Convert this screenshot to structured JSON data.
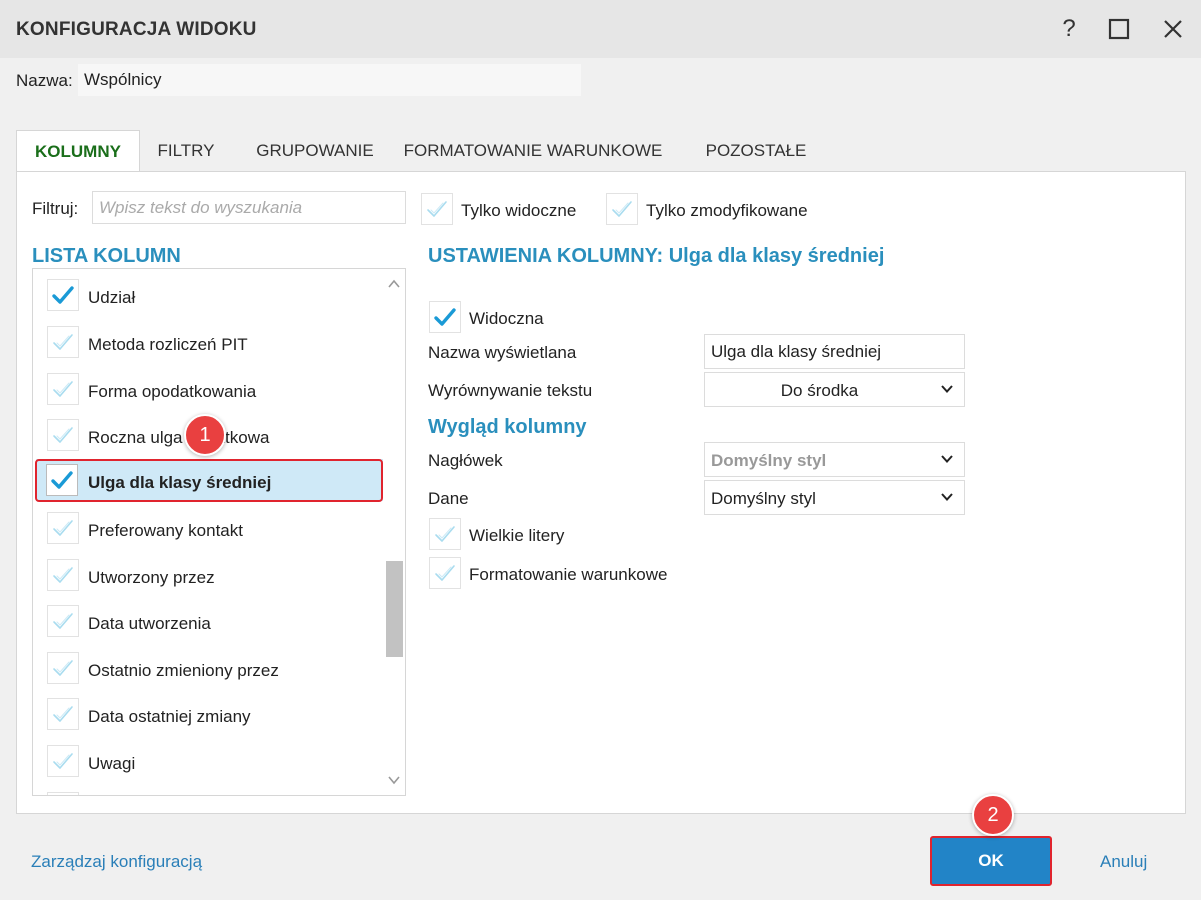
{
  "window": {
    "title": "KONFIGURACJA WIDOKU",
    "help_icon": "question-icon",
    "maximize_icon": "maximize-icon",
    "close_icon": "close-icon"
  },
  "name": {
    "label": "Nazwa:",
    "value": "Wspólnicy"
  },
  "tabs": [
    {
      "label": "KOLUMNY",
      "active": true
    },
    {
      "label": "FILTRY",
      "active": false
    },
    {
      "label": "GRUPOWANIE",
      "active": false
    },
    {
      "label": "FORMATOWANIE WARUNKOWE",
      "active": false
    },
    {
      "label": "POZOSTAŁE",
      "active": false
    }
  ],
  "filter": {
    "label": "Filtruj:",
    "placeholder": "Wpisz tekst do wyszukania",
    "only_visible": {
      "label": "Tylko widoczne",
      "checked": false
    },
    "only_modified": {
      "label": "Tylko zmodyfikowane",
      "checked": false
    }
  },
  "column_list": {
    "heading": "LISTA KOLUMN",
    "items": [
      {
        "label": "Udział",
        "checked": true
      },
      {
        "label": "Metoda rozliczeń PIT",
        "checked": false
      },
      {
        "label": "Forma opodatkowania",
        "checked": false
      },
      {
        "label": "Roczna ulga podatkowa",
        "checked": false
      },
      {
        "label": "Ulga dla klasy średniej",
        "checked": true,
        "selected": true
      },
      {
        "label": "Preferowany kontakt",
        "checked": false
      },
      {
        "label": "Utworzony przez",
        "checked": false
      },
      {
        "label": "Data utworzenia",
        "checked": false
      },
      {
        "label": "Ostatnio zmieniony przez",
        "checked": false
      },
      {
        "label": "Data ostatniej zmiany",
        "checked": false
      },
      {
        "label": "Uwagi",
        "checked": false
      }
    ]
  },
  "settings": {
    "heading": "USTAWIENIA KOLUMNY: Ulga dla klasy średniej",
    "visible": {
      "label": "Widoczna",
      "checked": true
    },
    "display_name": {
      "label": "Nazwa wyświetlana",
      "value": "Ulga dla klasy średniej"
    },
    "text_align": {
      "label": "Wyrównywanie tekstu",
      "value": "Do środka"
    },
    "appearance_heading": "Wygląd kolumny",
    "header_style": {
      "label": "Nagłówek",
      "value": "Domyślny styl"
    },
    "data_style": {
      "label": "Dane",
      "value": "Domyślny styl"
    },
    "uppercase": {
      "label": "Wielkie litery",
      "checked": false
    },
    "conditional_formatting": {
      "label": "Formatowanie warunkowe",
      "checked": false
    }
  },
  "badges": {
    "first": "1",
    "second": "2"
  },
  "footer": {
    "manage_label": "Zarządzaj konfiguracją",
    "ok_label": "OK",
    "cancel_label": "Anuluj"
  },
  "colors": {
    "accent": "#2a8fbd",
    "check": "#1a9ad6",
    "check_light": "#a9dcef",
    "ok_button": "#2284c7",
    "highlight": "#e0242e",
    "active_tab": "#1a6e1a"
  }
}
